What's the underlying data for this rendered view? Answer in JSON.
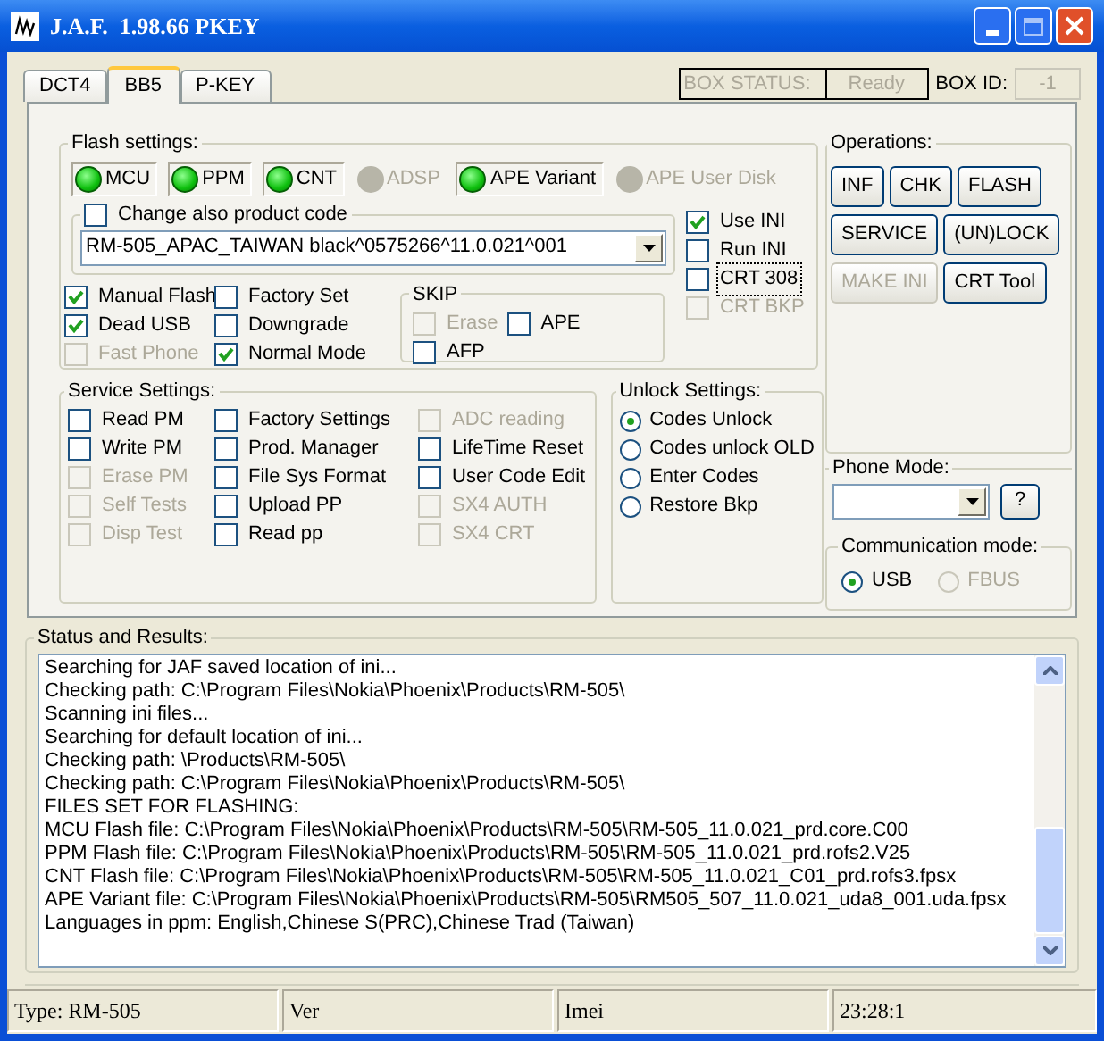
{
  "window": {
    "title": "J.A.F.  1.98.66 PKEY"
  },
  "tabs": [
    {
      "label": "DCT4",
      "selected": false
    },
    {
      "label": "BB5",
      "selected": true
    },
    {
      "label": "P-KEY",
      "selected": false
    }
  ],
  "box_status": {
    "label": "BOX STATUS:",
    "value": "Ready"
  },
  "box_id": {
    "label": "BOX ID:",
    "value": "-1"
  },
  "flash_settings": {
    "title": "Flash settings:",
    "files": [
      {
        "label": "MCU",
        "enabled": true
      },
      {
        "label": "PPM",
        "enabled": true
      },
      {
        "label": "CNT",
        "enabled": true
      },
      {
        "label": "ADSP",
        "enabled": false
      },
      {
        "label": "APE Variant",
        "enabled": true
      },
      {
        "label": "APE User Disk",
        "enabled": false
      }
    ],
    "change_product_code": {
      "label": "Change also product code",
      "checked": false
    },
    "product_code": "RM-505_APAC_TAIWAN black^0575266^11.0.021^001",
    "ini_options": [
      {
        "label": "Use INI",
        "checked": true,
        "disabled": false,
        "focused": false
      },
      {
        "label": "Run INI",
        "checked": false,
        "disabled": false,
        "focused": false
      },
      {
        "label": "CRT 308",
        "checked": false,
        "disabled": false,
        "focused": true
      },
      {
        "label": "CRT BKP",
        "checked": false,
        "disabled": true,
        "focused": false
      }
    ],
    "mode_options": [
      {
        "label": "Manual Flash",
        "checked": true,
        "disabled": false
      },
      {
        "label": "Dead USB",
        "checked": true,
        "disabled": false
      },
      {
        "label": "Fast Phone",
        "checked": false,
        "disabled": true
      }
    ],
    "extra_options": [
      {
        "label": "Factory Set",
        "checked": false,
        "disabled": false
      },
      {
        "label": "Downgrade",
        "checked": false,
        "disabled": false
      },
      {
        "label": "Normal Mode",
        "checked": true,
        "disabled": false
      }
    ],
    "skip": {
      "title": "SKIP",
      "options": [
        {
          "label": "Erase",
          "checked": false,
          "disabled": true
        },
        {
          "label": "APE",
          "checked": false,
          "disabled": false
        },
        {
          "label": "AFP",
          "checked": false,
          "disabled": false
        }
      ]
    }
  },
  "service_settings": {
    "title": "Service Settings:",
    "columns": [
      [
        {
          "label": "Read PM",
          "checked": false,
          "disabled": false
        },
        {
          "label": "Write PM",
          "checked": false,
          "disabled": false
        },
        {
          "label": "Erase PM",
          "checked": false,
          "disabled": true
        },
        {
          "label": "Self Tests",
          "checked": false,
          "disabled": true
        },
        {
          "label": "Disp Test",
          "checked": false,
          "disabled": true
        }
      ],
      [
        {
          "label": "Factory Settings",
          "checked": false,
          "disabled": false
        },
        {
          "label": "Prod. Manager",
          "checked": false,
          "disabled": false
        },
        {
          "label": "File Sys Format",
          "checked": false,
          "disabled": false
        },
        {
          "label": "Upload PP",
          "checked": false,
          "disabled": false
        },
        {
          "label": "Read pp",
          "checked": false,
          "disabled": false
        }
      ],
      [
        {
          "label": "ADC reading",
          "checked": false,
          "disabled": true
        },
        {
          "label": "LifeTime Reset",
          "checked": false,
          "disabled": false
        },
        {
          "label": "User Code Edit",
          "checked": false,
          "disabled": false
        },
        {
          "label": "SX4 AUTH",
          "checked": false,
          "disabled": true
        },
        {
          "label": "SX4 CRT",
          "checked": false,
          "disabled": true
        }
      ]
    ]
  },
  "unlock_settings": {
    "title": "Unlock Settings:",
    "options": [
      {
        "label": "Codes Unlock",
        "selected": true
      },
      {
        "label": "Codes unlock OLD",
        "selected": false
      },
      {
        "label": "Enter Codes",
        "selected": false
      },
      {
        "label": "Restore Bkp",
        "selected": false
      }
    ]
  },
  "operations": {
    "title": "Operations:",
    "buttons": [
      {
        "label": "INF",
        "disabled": false
      },
      {
        "label": "CHK",
        "disabled": false
      },
      {
        "label": "FLASH",
        "disabled": false
      },
      {
        "label": "SERVICE",
        "disabled": false
      },
      {
        "label": "(UN)LOCK",
        "disabled": false
      },
      {
        "label": "MAKE INI",
        "disabled": true
      },
      {
        "label": "CRT Tool",
        "disabled": false
      }
    ]
  },
  "phone_mode": {
    "title": "Phone Mode:",
    "help_button": "?"
  },
  "communication_mode": {
    "title": "Communication mode:",
    "options": [
      {
        "label": "USB",
        "selected": true,
        "disabled": false
      },
      {
        "label": "FBUS",
        "selected": false,
        "disabled": true
      }
    ]
  },
  "status_results": {
    "title": "Status and Results:",
    "lines": [
      "Searching for JAF saved location of ini...",
      "Checking path: C:\\Program Files\\Nokia\\Phoenix\\Products\\RM-505\\",
      "Scanning ini files...",
      "Searching for default location of ini...",
      "Checking path: \\Products\\RM-505\\",
      "Checking path: C:\\Program Files\\Nokia\\Phoenix\\Products\\RM-505\\",
      "FILES SET FOR FLASHING:",
      "MCU Flash file: C:\\Program Files\\Nokia\\Phoenix\\Products\\RM-505\\RM-505_11.0.021_prd.core.C00",
      "PPM Flash file: C:\\Program Files\\Nokia\\Phoenix\\Products\\RM-505\\RM-505_11.0.021_prd.rofs2.V25",
      "CNT Flash file: C:\\Program Files\\Nokia\\Phoenix\\Products\\RM-505\\RM-505_11.0.021_C01_prd.rofs3.fpsx",
      "APE Variant file: C:\\Program Files\\Nokia\\Phoenix\\Products\\RM-505\\RM505_507_11.0.021_uda8_001.uda.fpsx",
      "Languages in ppm: English,Chinese S(PRC),Chinese Trad (Taiwan)"
    ]
  },
  "status_bar": [
    "Type: RM-505",
    "Ver",
    "Imei",
    "23:28:1"
  ]
}
